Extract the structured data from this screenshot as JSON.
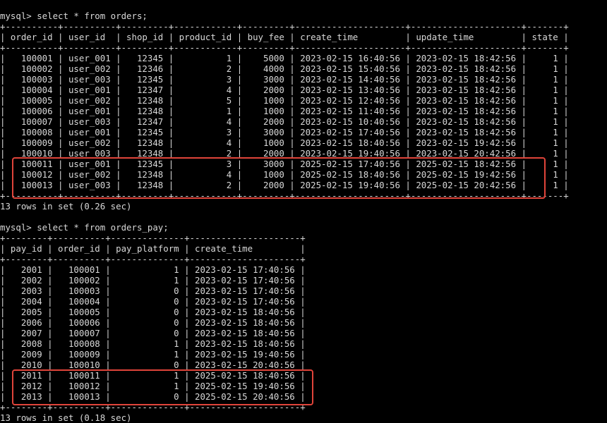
{
  "terminal": {
    "lines": [
      "mysql> select * from orders;",
      "+----------+----------+---------+------------+---------+---------------------+---------------------+-------+",
      "| order_id | user_id  | shop_id | product_id | buy_fee | create_time         | update_time         | state |",
      "+----------+----------+---------+------------+---------+---------------------+---------------------+-------+",
      "|   100001 | user_001 |   12345 |          1 |    5000 | 2023-02-15 16:40:56 | 2023-02-15 18:42:56 |     1 |",
      "|   100002 | user_002 |   12346 |          2 |    4000 | 2023-02-15 15:40:56 | 2023-02-15 18:42:56 |     1 |",
      "|   100003 | user_003 |   12345 |          3 |    3000 | 2023-02-15 14:40:56 | 2023-02-15 18:42:56 |     1 |",
      "|   100004 | user_001 |   12347 |          4 |    2000 | 2023-02-15 13:40:56 | 2023-02-15 18:42:56 |     1 |",
      "|   100005 | user_002 |   12348 |          5 |    1000 | 2023-02-15 12:40:56 | 2023-02-15 18:42:56 |     1 |",
      "|   100006 | user_001 |   12348 |          1 |    1000 | 2023-02-15 11:40:56 | 2023-02-15 18:42:56 |     1 |",
      "|   100007 | user_003 |   12347 |          4 |    2000 | 2023-02-15 10:40:56 | 2023-02-15 18:42:56 |     1 |",
      "|   100008 | user_001 |   12345 |          3 |    3000 | 2023-02-15 17:40:56 | 2023-02-15 18:42:56 |     1 |",
      "|   100009 | user_002 |   12348 |          4 |    1000 | 2023-02-15 18:40:56 | 2023-02-15 19:42:56 |     1 |",
      "|   100010 | user_003 |   12348 |          2 |    2000 | 2023-02-15 19:40:56 | 2023-02-15 20:42:56 |     1 |",
      "|   100011 | user_001 |   12345 |          3 |    3000 | 2025-02-15 17:40:56 | 2025-02-15 18:42:56 |     1 |",
      "|   100012 | user_002 |   12348 |          4 |    1000 | 2025-02-15 18:40:56 | 2025-02-15 19:42:56 |     1 |",
      "|   100013 | user_003 |   12348 |          2 |    2000 | 2025-02-15 19:40:56 | 2025-02-15 20:42:56 |     1 |",
      "+----------+----------+---------+------------+---------+---------------------+---------------------+-------+",
      "13 rows in set (0.26 sec)",
      "",
      "mysql> select * from orders_pay;",
      "+--------+----------+--------------+---------------------+",
      "| pay_id | order_id | pay_platform | create_time         |",
      "+--------+----------+--------------+---------------------+",
      "|   2001 |   100001 |            1 | 2023-02-15 17:40:56 |",
      "|   2002 |   100002 |            1 | 2023-02-15 17:40:56 |",
      "|   2003 |   100003 |            0 | 2023-02-15 17:40:56 |",
      "|   2004 |   100004 |            0 | 2023-02-15 17:40:56 |",
      "|   2005 |   100005 |            0 | 2023-02-15 18:40:56 |",
      "|   2006 |   100006 |            0 | 2023-02-15 18:40:56 |",
      "|   2007 |   100007 |            0 | 2023-02-15 18:40:56 |",
      "|   2008 |   100008 |            1 | 2023-02-15 18:40:56 |",
      "|   2009 |   100009 |            1 | 2023-02-15 19:40:56 |",
      "|   2010 |   100010 |            0 | 2023-02-15 20:40:56 |",
      "|   2011 |   100011 |            1 | 2025-02-15 18:40:56 |",
      "|   2012 |   100012 |            1 | 2025-02-15 19:40:56 |",
      "|   2013 |   100013 |            0 | 2025-02-15 20:40:56 |",
      "+--------+----------+--------------+---------------------+",
      "13 rows in set (0.18 sec)"
    ]
  },
  "colors": {
    "background": "#000000",
    "text": "#d8d8d8",
    "highlight": "#e0443a"
  }
}
